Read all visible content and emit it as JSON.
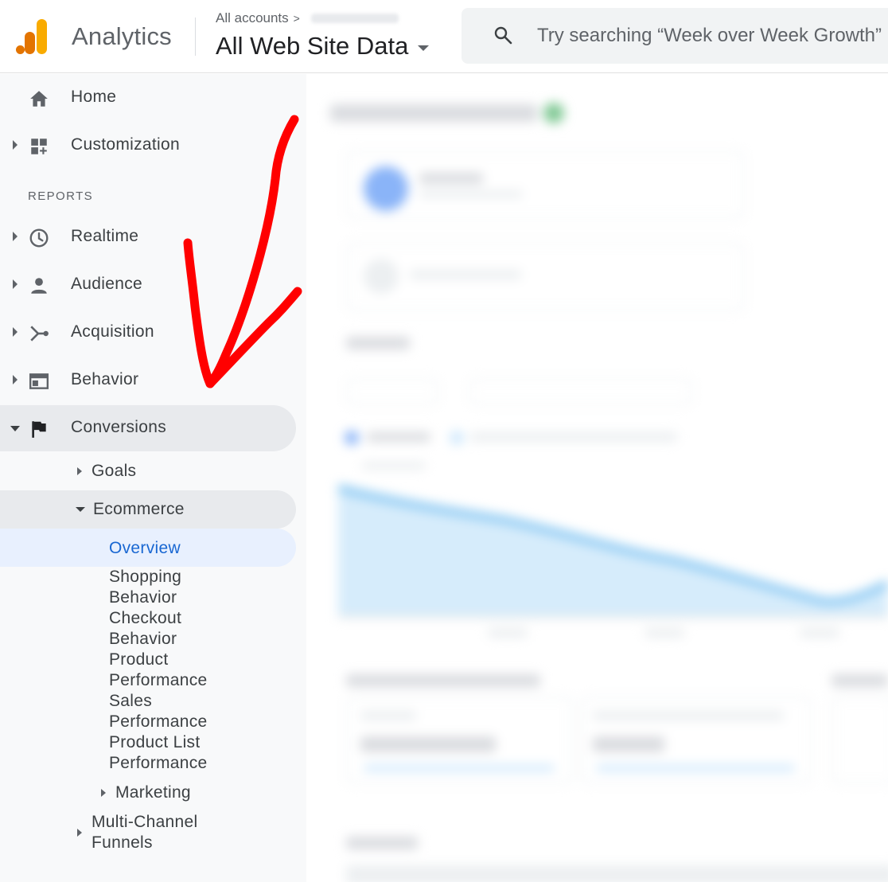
{
  "header": {
    "product_name": "Analytics",
    "accounts_label": "All accounts",
    "property_name": "All Web Site Data",
    "search_placeholder": "Try searching “Week over Week Growth”"
  },
  "sidebar": {
    "items": [
      {
        "label": "Home",
        "icon": "home-icon"
      },
      {
        "label": "Customization",
        "icon": "dashboard-icon"
      }
    ],
    "reports_heading": "REPORTS",
    "report_items": [
      {
        "label": "Realtime",
        "icon": "clock-icon"
      },
      {
        "label": "Audience",
        "icon": "person-icon"
      },
      {
        "label": "Acquisition",
        "icon": "acquisition-icon"
      },
      {
        "label": "Behavior",
        "icon": "behavior-icon"
      },
      {
        "label": "Conversions",
        "icon": "flag-icon",
        "expanded": true
      }
    ],
    "conversions": {
      "goals": "Goals",
      "ecommerce": "Ecommerce",
      "ecommerce_children": {
        "overview": "Overview",
        "shopping_behavior": [
          "Shopping",
          "Behavior"
        ],
        "checkout_behavior": [
          "Checkout",
          "Behavior"
        ],
        "product_performance": [
          "Product",
          "Performance"
        ],
        "sales_performance": [
          "Sales",
          "Performance"
        ],
        "product_list_performance": [
          "Product List",
          "Performance"
        ]
      },
      "marketing": "Marketing",
      "multi_channel_funnels": [
        "Multi-Channel",
        "Funnels"
      ]
    }
  },
  "colors": {
    "accent_blue": "#1967d2",
    "active_bg": "#e8eaed",
    "overview_bg": "#e8f0fe",
    "annotation_red": "#ff0000",
    "logo_orange": "#e37400",
    "logo_yellow": "#f9ab00"
  }
}
